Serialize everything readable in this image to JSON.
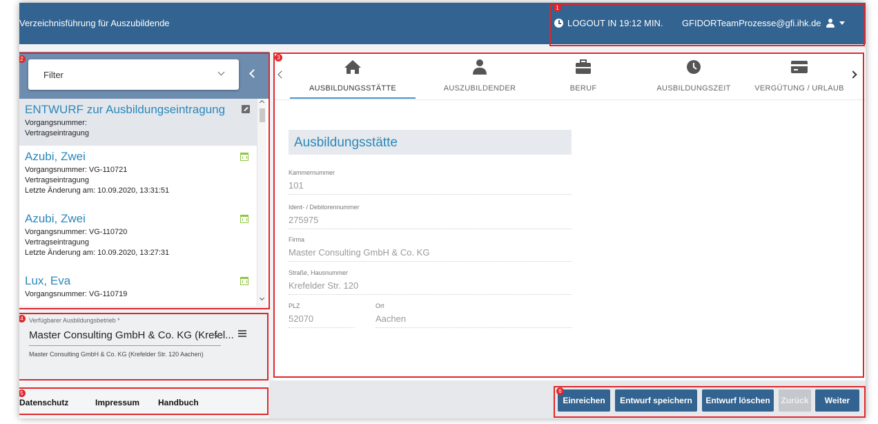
{
  "header": {
    "title": "Verzeichnisführung für Auszubildende",
    "logout": "LOGOUT IN 19:12 MIN.",
    "user": "GFIDORTeamProzesse@gfi.ihk.de"
  },
  "markers": [
    "1",
    "2",
    "3",
    "4",
    "5",
    "6"
  ],
  "sidebar": {
    "filter_label": "Filter",
    "items": [
      {
        "name": "ENTWURF zur Ausbildungseintragung",
        "line1": "Vorgangsnummer:",
        "line2": "Vertragseintragung",
        "line3": ""
      },
      {
        "name": "Azubi, Zwei",
        "line1": "Vorgangsnummer: VG-110721",
        "line2": "Vertragseintragung",
        "line3": "Letzte Änderung am: 10.09.2020, 13:31:51"
      },
      {
        "name": "Azubi, Zwei",
        "line1": "Vorgangsnummer: VG-110720",
        "line2": "Vertragseintragung",
        "line3": "Letzte Änderung am: 10.09.2020, 13:27:31"
      },
      {
        "name": "Lux, Eva",
        "line1": "Vorgangsnummer: VG-110719",
        "line2": "",
        "line3": ""
      }
    ],
    "betrieb": {
      "label": "Verfügbarer Ausbildungsbetrieb *",
      "value": "Master Consulting GmbH & Co. KG (Krefel...",
      "address": "Master Consulting GmbH & Co. KG (Krefelder Str. 120 Aachen)"
    }
  },
  "footer": {
    "links": [
      "Datenschutz",
      "Impressum",
      "Handbuch"
    ],
    "buttons": [
      "Einreichen",
      "Entwurf speichern",
      "Entwurf löschen",
      "Zurück",
      "Weiter"
    ]
  },
  "tabs": [
    {
      "label": "AUSBILDUNGSSTÄTTE",
      "icon": "home-icon",
      "active": true
    },
    {
      "label": "AUSZUBILDENDER",
      "icon": "person-icon",
      "active": false
    },
    {
      "label": "BERUF",
      "icon": "briefcase-icon",
      "active": false
    },
    {
      "label": "AUSBILDUNGSZEIT",
      "icon": "clock-icon",
      "active": false
    },
    {
      "label": "VERGÜTUNG / URLAUB",
      "icon": "credit-card-icon",
      "active": false
    }
  ],
  "form": {
    "section_title": "Ausbildungsstätte",
    "fields": [
      {
        "label": "Kammernummer",
        "value": "101"
      },
      {
        "label": "Ident- / Debitorennummer",
        "value": "275975"
      },
      {
        "label": "Firma",
        "value": "Master Consulting GmbH & Co. KG"
      },
      {
        "label": "Straße, Hausnummer",
        "value": "Krefelder Str. 120"
      }
    ],
    "plz": {
      "label": "PLZ",
      "value": "52070"
    },
    "ort": {
      "label": "Ort",
      "value": "Aachen"
    }
  },
  "colors": {
    "header": "#336390",
    "accent": "#2b87b9",
    "annotation": "#e0262a",
    "calendar_icon": "#8cc63f"
  }
}
